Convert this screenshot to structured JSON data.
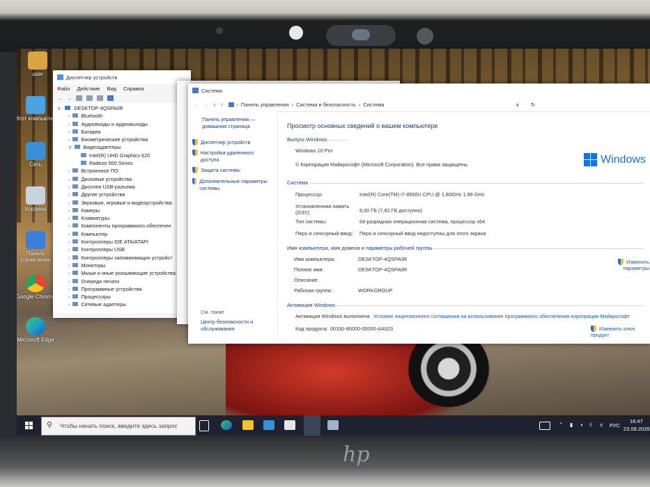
{
  "desktop": {
    "icons": [
      {
        "label": "user",
        "color": "#d9a441"
      },
      {
        "label": "Этот компьютер",
        "color": "#4aa3e0"
      },
      {
        "label": "Сеть",
        "color": "#3a8fd6"
      },
      {
        "label": "Корзина",
        "color": "#c9d3dd"
      },
      {
        "label": "Панель управления",
        "color": "#3c7ed9"
      },
      {
        "label": "Google Chrome",
        "color": "#e5462f"
      },
      {
        "label": "Microsoft Edge",
        "color": "#1fa3c4"
      }
    ]
  },
  "device_manager": {
    "title": "Диспетчер устройств",
    "menu": [
      "Файл",
      "Действие",
      "Вид",
      "Справка"
    ],
    "root": "DESKTOP-4QSPA0R",
    "items": [
      {
        "label": "Bluetooth",
        "expanded": false
      },
      {
        "label": "Аудиовходы и аудиовыходы",
        "expanded": false
      },
      {
        "label": "Батареи",
        "expanded": false
      },
      {
        "label": "Биометрические устройства",
        "expanded": false
      },
      {
        "label": "Видеоадаптеры",
        "expanded": true
      },
      {
        "label": "Intel(R) UHD Graphics 620",
        "child": true
      },
      {
        "label": "Radeon 500 Series",
        "child": true
      },
      {
        "label": "Встроенное ПО",
        "expanded": false
      },
      {
        "label": "Дисковые устройства",
        "expanded": false
      },
      {
        "label": "Дисплеи USB-разъема",
        "expanded": false
      },
      {
        "label": "Другие устройства",
        "expanded": false
      },
      {
        "label": "Звуковые, игровые и видеоустройства",
        "expanded": false
      },
      {
        "label": "Камеры",
        "expanded": false
      },
      {
        "label": "Клавиатуры",
        "expanded": false
      },
      {
        "label": "Компоненты программного обеспечен",
        "expanded": false
      },
      {
        "label": "Компьютер",
        "expanded": false
      },
      {
        "label": "Контроллеры IDE ATA/ATAPI",
        "expanded": false
      },
      {
        "label": "Контроллеры USB",
        "expanded": false
      },
      {
        "label": "Контроллеры запоминающих устройст",
        "expanded": false
      },
      {
        "label": "Мониторы",
        "expanded": false
      },
      {
        "label": "Мыши и иные указывающие устройства",
        "expanded": false
      },
      {
        "label": "Очереди печати",
        "expanded": false
      },
      {
        "label": "Программные устройства",
        "expanded": false
      },
      {
        "label": "Процессоры",
        "expanded": false
      },
      {
        "label": "Сетевые адаптеры",
        "expanded": false
      }
    ]
  },
  "system": {
    "title": "Система",
    "breadcrumb": [
      "Панель управления",
      "Система и безопасность",
      "Система"
    ],
    "left_home": "Панель управления — домашняя страница",
    "left_links": [
      "Диспетчер устройств",
      "Настройка удаленного доступа",
      "Защита системы",
      "Дополнительные параметры системы"
    ],
    "see_also": "См. также",
    "see_also_link": "Центр безопасности и обслуживания",
    "heading": "Просмотр основных сведений о вашем компьютере",
    "edition_section": "Выпуск Windows",
    "edition": "Windows 10 Pro",
    "copyright": "© Корпорация Майкрософт (Microsoft Corporation). Все права защищены.",
    "windows_logo_text": "Windows",
    "system_section": "Система",
    "system_rows": [
      {
        "k": "Процессор:",
        "v": "Intel(R) Core(TM) i7-8550U CPU @ 1.80GHz   1.99 GHz"
      },
      {
        "k": "Установленная память (ОЗУ):",
        "v": "8,00 ГБ (7,82 ГБ доступно)"
      },
      {
        "k": "Тип системы:",
        "v": "64-разрядная операционная система, процессор x64"
      },
      {
        "k": "Перо и сенсорный ввод:",
        "v": "Перо и сенсорный ввод недоступны для этого экрана"
      }
    ],
    "name_section": "Имя компьютера, имя домена и параметры рабочей группы",
    "name_rows": [
      {
        "k": "Имя компьютера:",
        "v": "DESKTOP-4QSPA0R"
      },
      {
        "k": "Полное имя:",
        "v": "DESKTOP-4QSPA0R"
      },
      {
        "k": "Описание:",
        "v": ""
      },
      {
        "k": "Рабочая группа:",
        "v": "WORKGROUP"
      }
    ],
    "change_params": "Изменить параметры",
    "activation_section": "Активация Windows",
    "activation_status": "Активация Windows выполнена",
    "license_link": "Условия лицензионного соглашения на использование программного обеспечения корпорации Майкрософт",
    "product_code_label": "Код продукта:",
    "product_code": "00330-80000-00000-AA923",
    "change_key": "Изменить ключ продукт"
  },
  "taskbar": {
    "search_placeholder": "Чтобы начать поиск, введите здесь запрос",
    "lang": "РУС",
    "time": "16:47",
    "date": "23.08.2026"
  },
  "laptop": {
    "brand": "hp"
  }
}
